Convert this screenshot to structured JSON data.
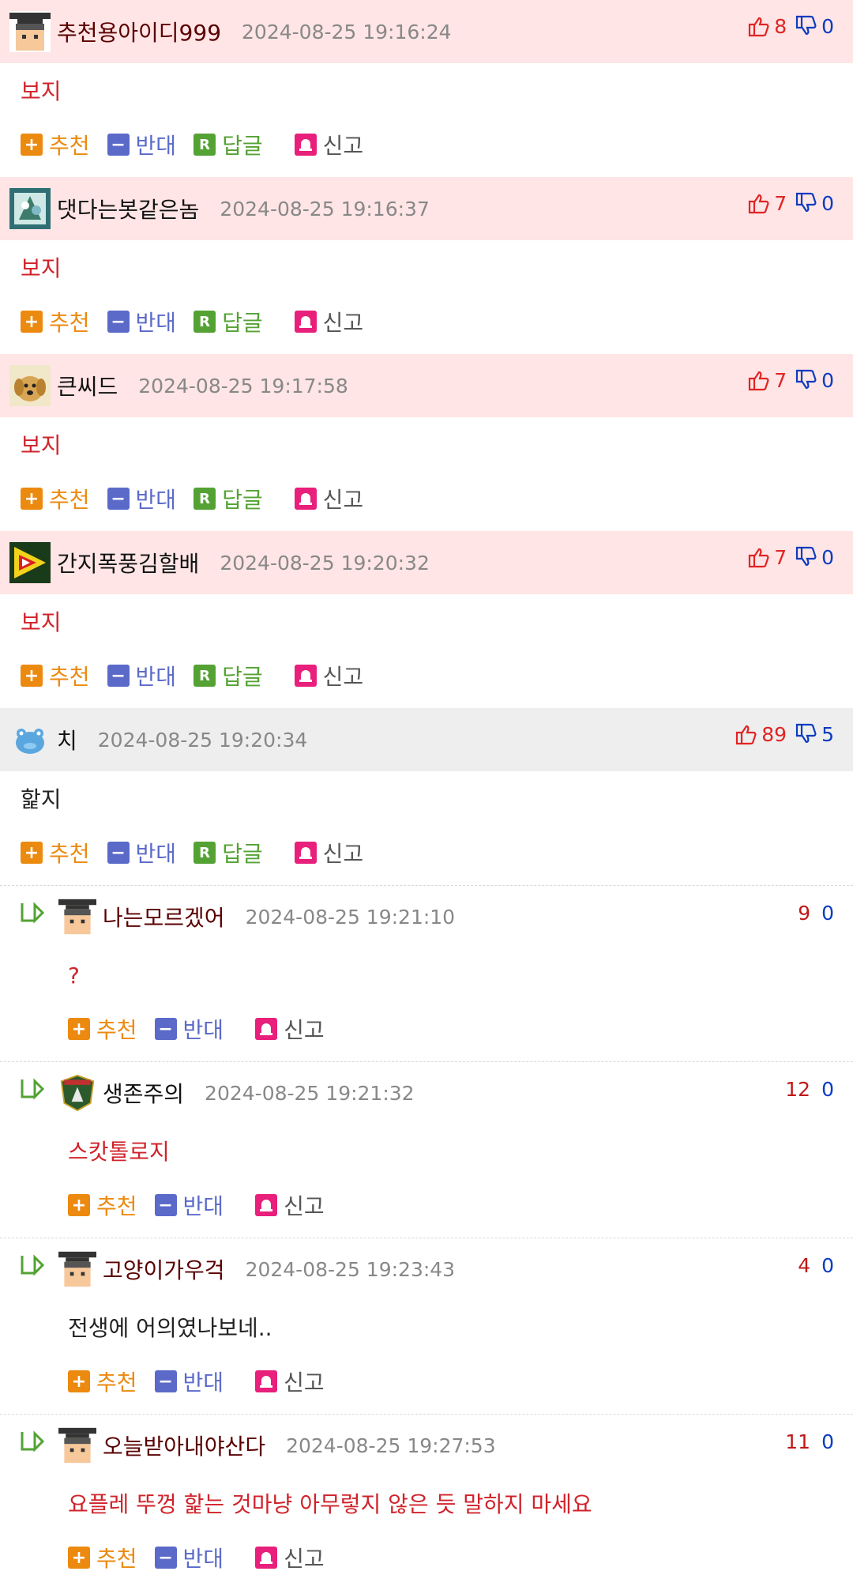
{
  "labels": {
    "recommend": "추천",
    "oppose": "반대",
    "reply": "답글",
    "report": "신고"
  },
  "comments": [
    {
      "nick": "추천용아이디999",
      "time": "2024-08-25 19:16:24",
      "up": "8",
      "down": "0",
      "text": "보지"
    },
    {
      "nick": "댓다는봇같은놈",
      "time": "2024-08-25 19:16:37",
      "up": "7",
      "down": "0",
      "text": "보지"
    },
    {
      "nick": "큰씨드",
      "time": "2024-08-25 19:17:58",
      "up": "7",
      "down": "0",
      "text": "보지"
    },
    {
      "nick": "간지폭풍김할배",
      "time": "2024-08-25 19:20:32",
      "up": "7",
      "down": "0",
      "text": "보지"
    },
    {
      "nick": "치",
      "time": "2024-08-25 19:20:34",
      "up": "89",
      "down": "5",
      "text": "핥지"
    }
  ],
  "replies": [
    {
      "nick": "나는모르겠어",
      "time": "2024-08-25 19:21:10",
      "up": "9",
      "down": "0",
      "text": "?"
    },
    {
      "nick": "생존주의",
      "time": "2024-08-25 19:21:32",
      "up": "12",
      "down": "0",
      "text": "스캇톨로지"
    },
    {
      "nick": "고양이가우걱",
      "time": "2024-08-25 19:23:43",
      "up": "4",
      "down": "0",
      "text": "전생에 어의였나보네.."
    },
    {
      "nick": "오늘받아내야산다",
      "time": "2024-08-25 19:27:53",
      "up": "11",
      "down": "0",
      "text": "요플레 뚜껑 핥는 것마냥 아무렇지 않은 듯 말하지 마세요"
    }
  ],
  "colors": {
    "like": "#e02424",
    "dislike": "#0b3bc0",
    "recommend": "#ec8a10",
    "oppose": "#5b6ac9",
    "reply": "#54a234",
    "report": "#e81f7b",
    "best_bg": "#ffe5e5"
  },
  "icons": [
    "thumb-up-icon",
    "thumb-down-icon",
    "plus-icon",
    "minus-icon",
    "reply-r-icon",
    "siren-icon",
    "reply-arrow-icon"
  ]
}
